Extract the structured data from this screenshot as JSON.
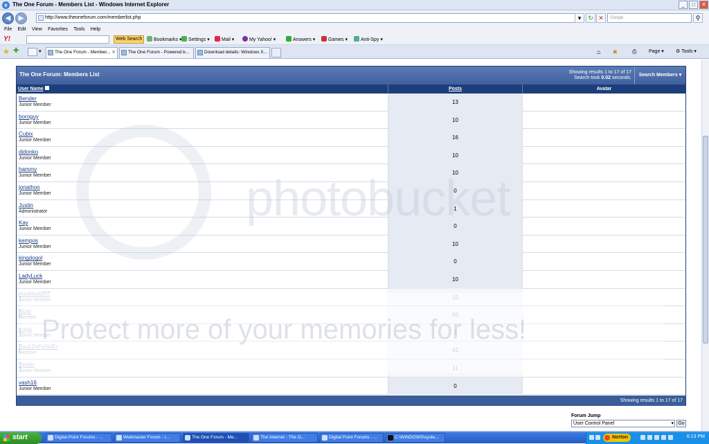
{
  "window": {
    "title": "The One Forum - Members List - Windows Internet Explorer",
    "controls": [
      "_",
      "□",
      "✕"
    ]
  },
  "address": {
    "url": "http://www.theoneforum.com/memberlist.php",
    "search_placeholder": "Google"
  },
  "menu": [
    "File",
    "Edit",
    "View",
    "Favorites",
    "Tools",
    "Help"
  ],
  "yahoo": {
    "logo": "Y!",
    "web_search": "Web Search",
    "items": [
      "Bookmarks ▾",
      "Settings ▾",
      "Mail ▾",
      "My Yahoo! ▾",
      "Answers ▾",
      "Games ▾",
      "Anti-Spy ▾"
    ]
  },
  "tabs": [
    "The One Forum - Member...",
    "The One Forum - Powered b...",
    "Download details: Windows X..."
  ],
  "right_tools": {
    "page": "Page ▾",
    "tools": "Tools ▾"
  },
  "forum": {
    "title": "The One Forum: Members List",
    "results_line": "Showing results 1 to 17 of 17",
    "search_time_prefix": "Search took ",
    "search_time": "0.02",
    "search_time_suffix": " seconds.",
    "search_members": "Search Members ▾",
    "columns": {
      "username": "User Name",
      "posts": "Posts",
      "avatar": "Avatar"
    },
    "members": [
      {
        "name": "Bender",
        "role": "Junior Member",
        "posts": "13"
      },
      {
        "name": "boroguy",
        "role": "Junior Member",
        "posts": "10"
      },
      {
        "name": "Cubix",
        "role": "Junior Member",
        "posts": "16"
      },
      {
        "name": "didonko",
        "role": "Junior Member",
        "posts": "10"
      },
      {
        "name": "hammy",
        "role": "Junior Member",
        "posts": "10"
      },
      {
        "name": "jonathon",
        "role": "Junior Member",
        "posts": "0"
      },
      {
        "name": "Justin",
        "role": "Administrator",
        "posts": "1"
      },
      {
        "name": "Kay",
        "role": "Junior Member",
        "posts": "0"
      },
      {
        "name": "kempos",
        "role": "Junior Member",
        "posts": "10"
      },
      {
        "name": "kingdogol",
        "role": "Junior Member",
        "posts": "0"
      },
      {
        "name": "LadyLuck",
        "role": "Junior Member",
        "posts": "10"
      },
      {
        "name": "maximus007",
        "role": "Junior Member",
        "posts": "10"
      },
      {
        "name": "Nizar",
        "role": "Member",
        "posts": "50"
      },
      {
        "name": "sciga",
        "role": "Junior Member",
        "posts": "2"
      },
      {
        "name": "SouLDeFeNdEr",
        "role": "Member",
        "posts": "42"
      },
      {
        "name": "Spider",
        "role": "Junior Member",
        "posts": "11"
      },
      {
        "name": "vash16",
        "role": "Junior Member",
        "posts": "0"
      }
    ],
    "footer": "Showing results 1 to 17 of 17"
  },
  "watermark": {
    "brand": "photobucket",
    "tagline": "Protect more of your memories for less!"
  },
  "forum_jump": {
    "label": "Forum Jump",
    "selected": "User Control Panel",
    "go": "Go"
  },
  "taskbar": {
    "start": "start",
    "tasks": [
      "Digital Point Forums - ...",
      "Webmaster Forum - I...",
      "The One Forum - Me...",
      "The Internet - The O...",
      "Digital Point Forums - ...",
      "C:\\WINDOWS\\syste..."
    ],
    "norton": "Norton",
    "clock": "6:13 PM"
  }
}
